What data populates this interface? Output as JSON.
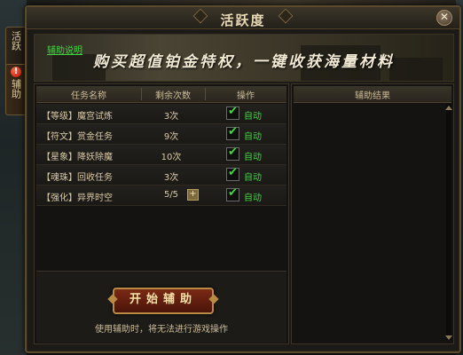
{
  "window": {
    "title": "活跃度"
  },
  "side_tabs": [
    {
      "label": "活跃"
    },
    {
      "label": "辅助",
      "alert": "!"
    }
  ],
  "banner": {
    "help_link": "辅助说明",
    "text": "购买超值铂金特权，一键收获海量材料"
  },
  "tasks": {
    "headers": {
      "name": "任务名称",
      "count": "剩余次数",
      "action": "操作"
    },
    "rows": [
      {
        "name": "【等级】魔宫试炼",
        "count": "3次",
        "checked": true,
        "action": "自动"
      },
      {
        "name": "【符文】赏金任务",
        "count": "9次",
        "checked": true,
        "action": "自动"
      },
      {
        "name": "【星象】降妖除魔",
        "count": "10次",
        "checked": true,
        "action": "自动"
      },
      {
        "name": "【魂珠】回收任务",
        "count": "3次",
        "checked": true,
        "action": "自动"
      },
      {
        "name": "【强化】异界时空",
        "count": "5/5",
        "checked": true,
        "action": "自动",
        "plus": "+"
      }
    ]
  },
  "results": {
    "header": "辅助结果"
  },
  "footer": {
    "start_button": "开始辅助",
    "notice": "使用辅助时，将无法进行游戏操作"
  },
  "colors": {
    "auto_text": "#3ed63e",
    "frame": "#5b4a2c",
    "button": "#7a2a14"
  }
}
